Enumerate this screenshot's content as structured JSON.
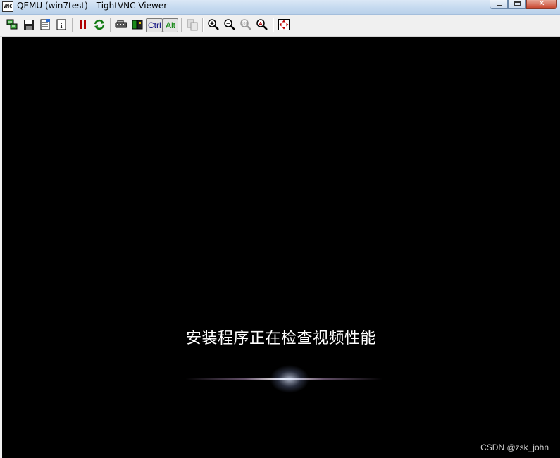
{
  "window": {
    "title": "QEMU (win7test) - TightVNC Viewer",
    "icon_label": "VNC"
  },
  "toolbar": {
    "ctrl_label": "Ctrl",
    "alt_label": "Alt",
    "icons": [
      "new-connection-icon",
      "save-icon",
      "options-icon",
      "info-icon",
      "pause-icon",
      "refresh-icon",
      "send-ctrl-alt-del-icon",
      "send-ctrl-esc-icon",
      "transfer-files-icon",
      "zoom-in-icon",
      "zoom-out-icon",
      "zoom-100-icon",
      "zoom-auto-icon",
      "fullscreen-icon"
    ]
  },
  "screen": {
    "message": "安装程序正在检查视频性能"
  },
  "watermark": "CSDN @zsk_john"
}
